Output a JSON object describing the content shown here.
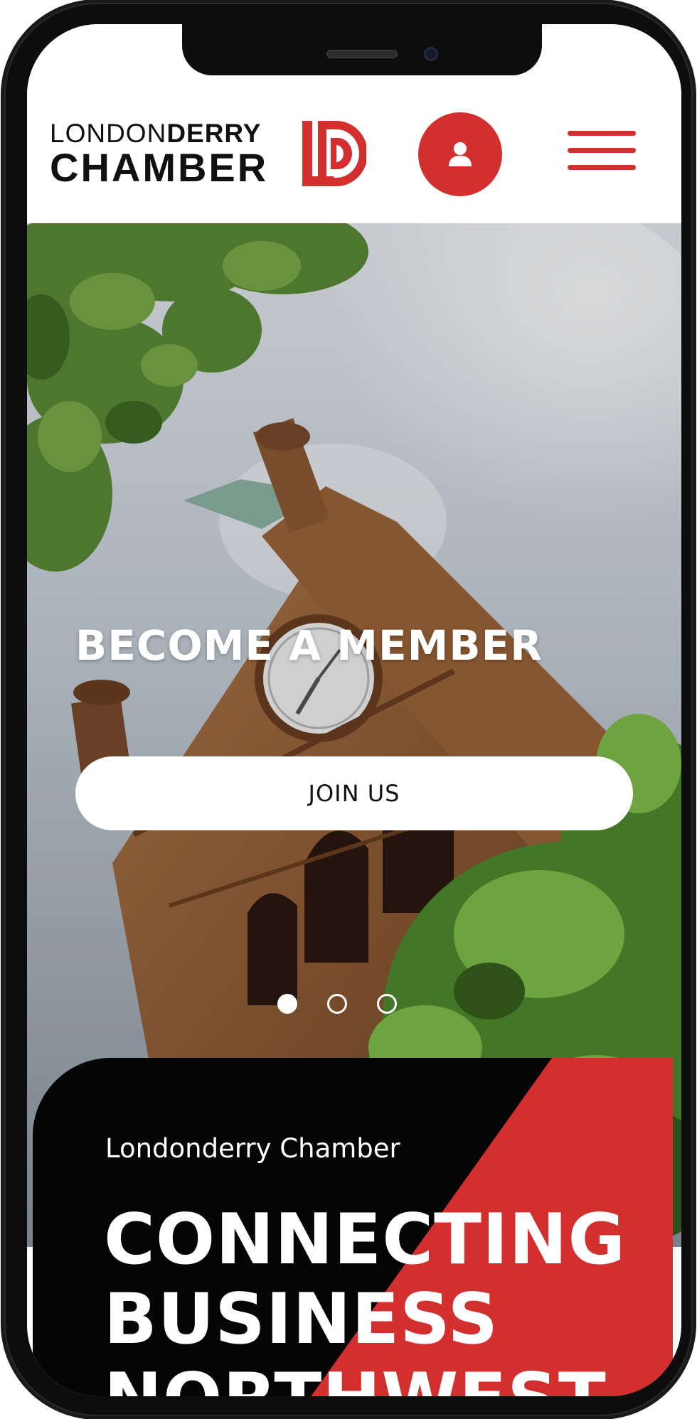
{
  "header": {
    "logo": {
      "line1_light": "LONDON",
      "line1_bold": "DERRY",
      "line2": "CHAMBER"
    },
    "account_icon": "user-icon",
    "menu_icon": "hamburger-menu-icon"
  },
  "hero": {
    "title": "BECOME A MEMBER",
    "cta_label": "JOIN US",
    "slides": 3,
    "active_slide": 1
  },
  "intro": {
    "subtitle": "Londonderry Chamber",
    "headline": [
      "CONNECTING",
      "BUSINESS",
      "NORTHWEST"
    ]
  },
  "colors": {
    "brand_red": "#d32f2f",
    "black": "#050505",
    "white": "#ffffff"
  }
}
